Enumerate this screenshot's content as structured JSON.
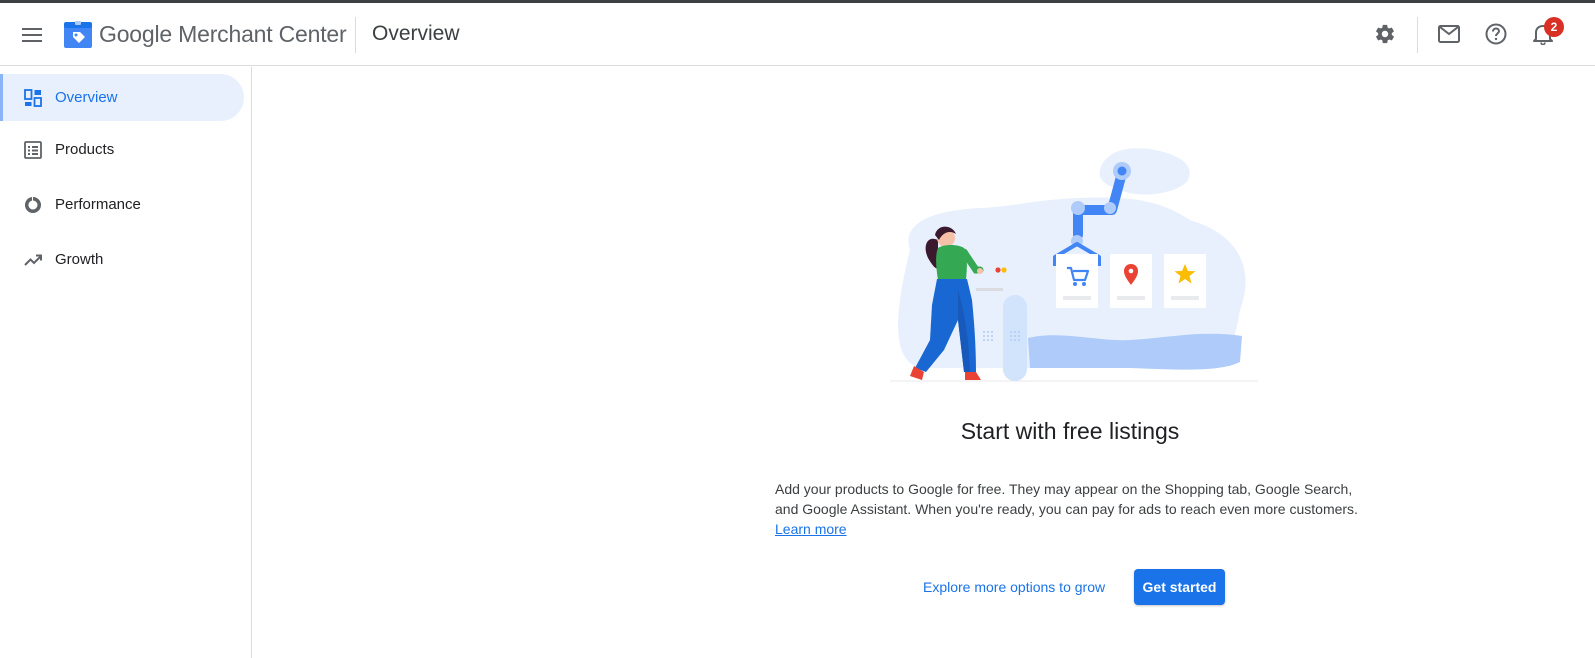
{
  "app": {
    "brand_google": "Google",
    "brand_product": "Merchant Center",
    "page_title": "Overview",
    "notification_count": "2"
  },
  "header_icons": [
    "menu-icon",
    "settings-gear-icon",
    "mail-icon",
    "help-icon",
    "notifications-bell-icon"
  ],
  "sidebar": {
    "items": [
      {
        "label": "Overview",
        "icon": "dashboard-icon",
        "active": true
      },
      {
        "label": "Products",
        "icon": "list-icon",
        "active": false
      },
      {
        "label": "Performance",
        "icon": "donut-chart-icon",
        "active": false
      },
      {
        "label": "Growth",
        "icon": "trending-up-icon",
        "active": false
      }
    ]
  },
  "main": {
    "headline": "Start with free listings",
    "description": "Add your products to Google for free. They may appear on the Shopping tab, Google Search, and Google Assistant. When you're ready, you can pay for ads to reach even more customers.",
    "learn_more": "Learn more",
    "explore_label": "Explore more options to grow",
    "get_started_label": "Get started"
  },
  "colors": {
    "accent": "#1a73e8",
    "active_nav_bg": "#e8f0fe",
    "badge": "#d93025"
  }
}
